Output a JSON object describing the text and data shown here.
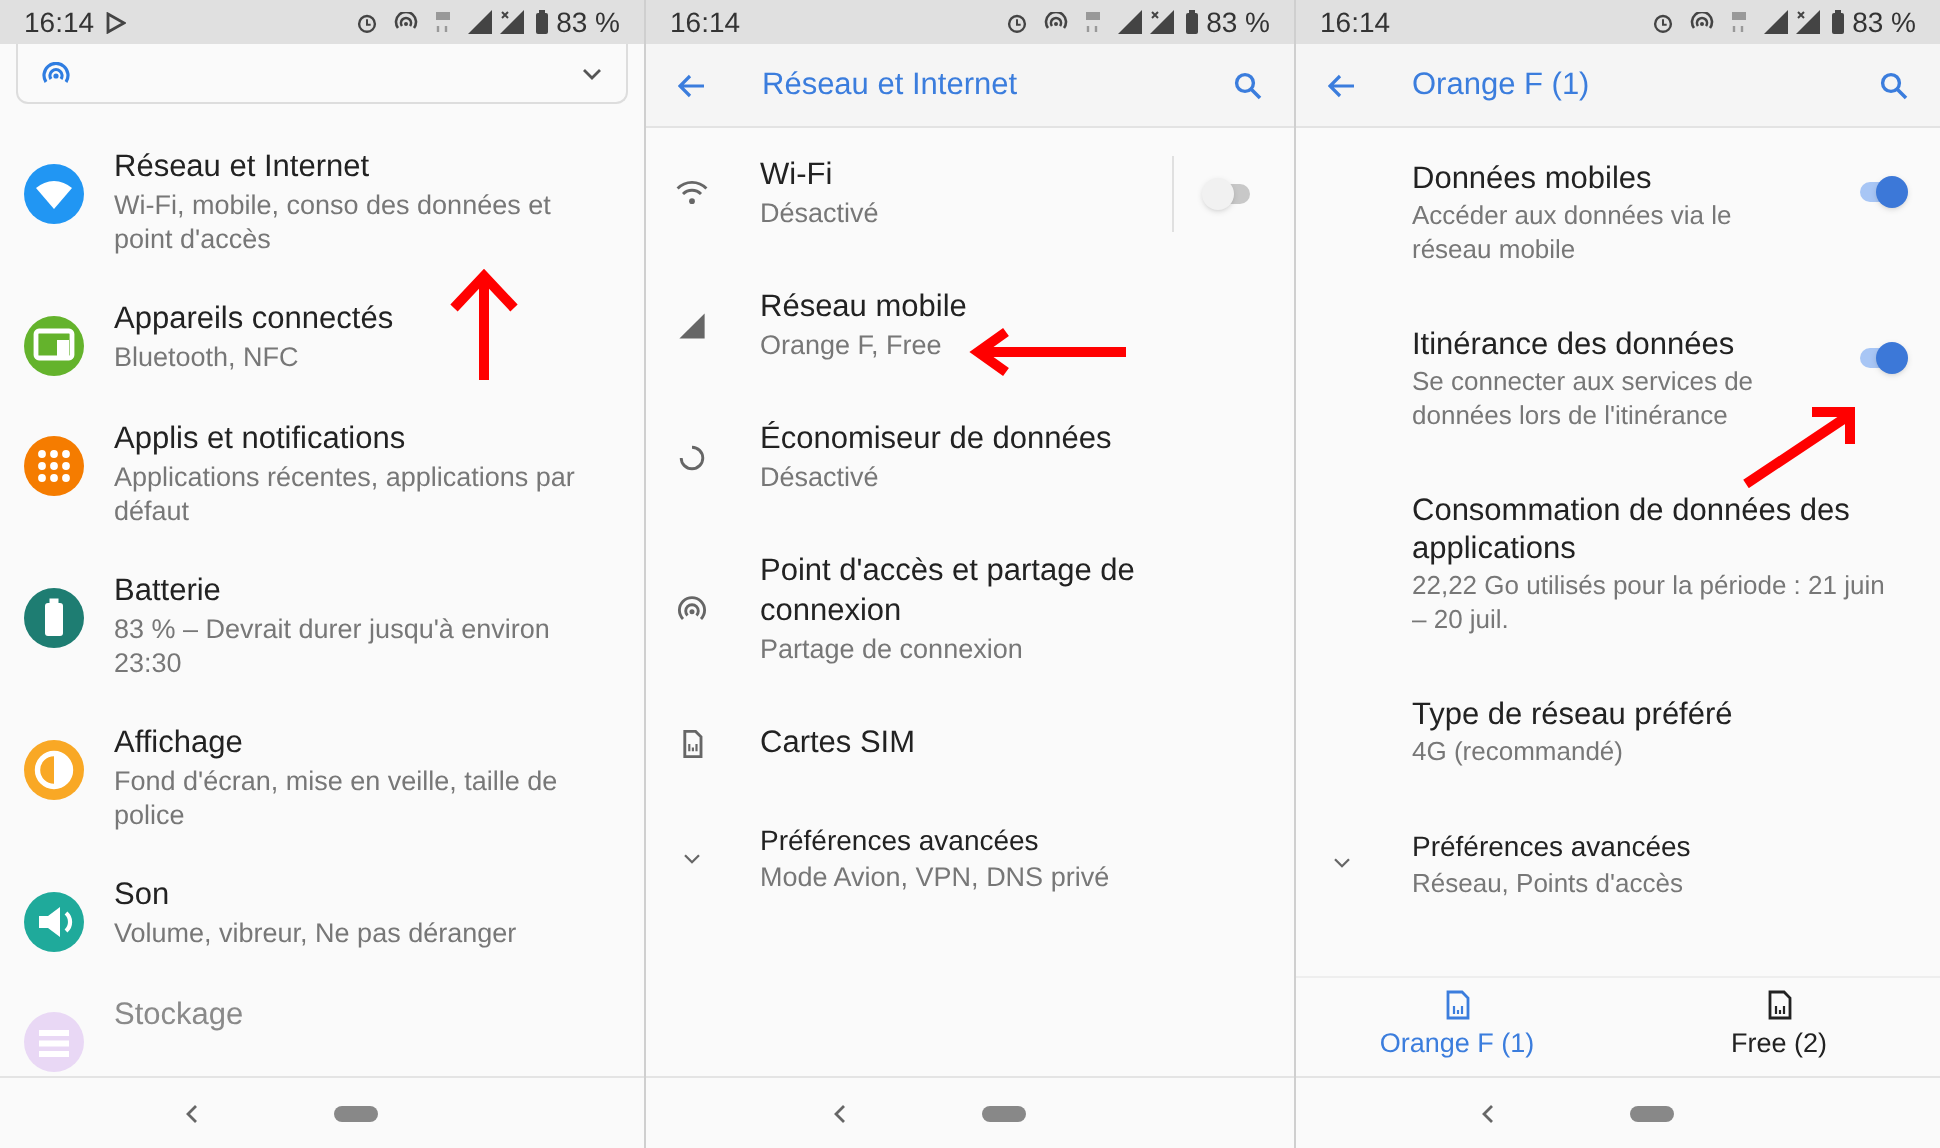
{
  "screens": [
    {
      "status_bar": {
        "time": "16:14",
        "battery": "83 %"
      },
      "items": [
        {
          "title": "Réseau et Internet",
          "subtitle": "Wi-Fi, mobile, conso des données et point d'accès",
          "color": "#2196f3"
        },
        {
          "title": "Appareils connectés",
          "subtitle": "Bluetooth, NFC",
          "color": "#64b32c"
        },
        {
          "title": "Applis et notifications",
          "subtitle": "Applications récentes, applications par défaut",
          "color": "#f57c00"
        },
        {
          "title": "Batterie",
          "subtitle": "83 % – Devrait durer jusqu'à environ 23:30",
          "color": "#1e7d72"
        },
        {
          "title": "Affichage",
          "subtitle": "Fond d'écran, mise en veille, taille de police",
          "color": "#f9a825"
        },
        {
          "title": "Son",
          "subtitle": "Volume, vibreur, Ne pas déranger",
          "color": "#1faa9b"
        },
        {
          "title": "Stockage",
          "color": "#e9d8f5"
        }
      ]
    },
    {
      "status_bar": {
        "time": "16:14",
        "battery": "83 %"
      },
      "header": {
        "title": "Réseau et Internet"
      },
      "items": [
        {
          "title": "Wi-Fi",
          "subtitle": "Désactivé",
          "on": false
        },
        {
          "title": "Réseau mobile",
          "subtitle": "Orange F, Free"
        },
        {
          "title": "Économiseur de données",
          "subtitle": "Désactivé"
        },
        {
          "title": "Point d'accès et partage de connexion",
          "subtitle": "Partage de connexion"
        },
        {
          "title": "Cartes SIM"
        },
        {
          "title": "Préférences avancées",
          "subtitle": "Mode Avion, VPN, DNS privé",
          "expanded": false
        }
      ]
    },
    {
      "status_bar": {
        "time": "16:14",
        "battery": "83 %"
      },
      "header": {
        "title": "Orange F (1)"
      },
      "items": [
        {
          "title": "Données mobiles",
          "subtitle": "Accéder aux données via le réseau mobile",
          "on": true
        },
        {
          "title": "Itinérance des données",
          "subtitle": "Se connecter aux services de données lors de l'itinérance",
          "on": true
        },
        {
          "title": "Consommation de données des applications",
          "subtitle": "22,22 Go utilisés pour la période : 21 juin – 20 juil."
        },
        {
          "title": "Type de réseau préféré",
          "subtitle": "4G (recommandé)"
        },
        {
          "title": "Préférences avancées",
          "subtitle": "Réseau, Points d'accès",
          "expanded": false
        }
      ],
      "tabs": [
        {
          "label": "Orange F (1)",
          "selected": true
        },
        {
          "label": "Free (2)",
          "selected": false
        }
      ]
    }
  ]
}
